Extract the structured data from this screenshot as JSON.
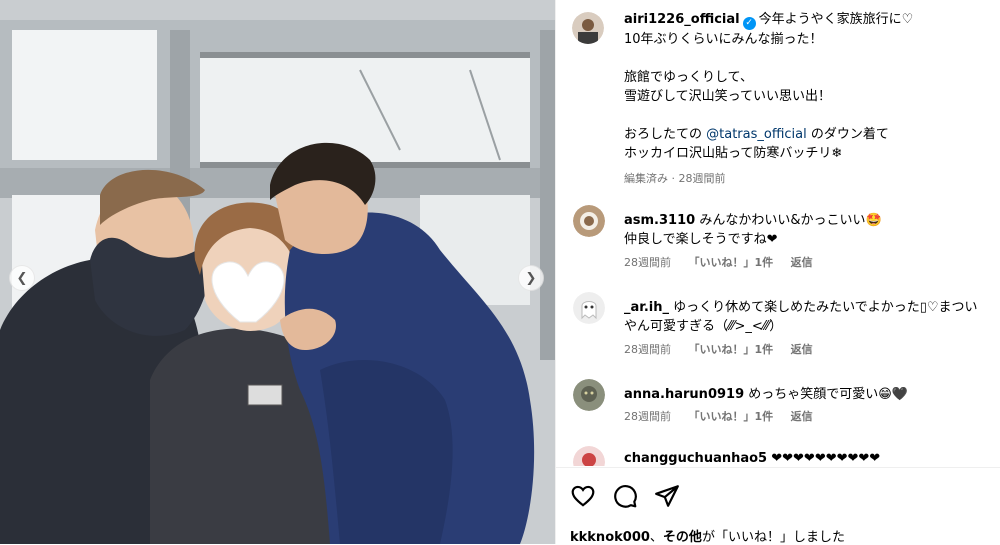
{
  "post": {
    "username": "airi1226_official",
    "caption_line1": "今年ようやく家族旅行に♡",
    "caption_line2": "10年ぶりくらいにみんな揃った！",
    "caption_line3": "旅館でゆっくりして、",
    "caption_line4": "雪遊びして沢山笑っていい思い出！",
    "caption_line5_pre": "おろしたての ",
    "caption_mention": "@tatras_official",
    "caption_line5_post": " のダウン着て",
    "caption_line6": "ホッカイロ沢山貼って防寒バッチリ❄",
    "meta": "編集済み · 28週間前"
  },
  "comments": [
    {
      "username": "asm.3110",
      "text_line1": "みんなかわいい&かっこいい🤩",
      "text_line2": "仲良しで楽しそうですね❤",
      "time": "28週間前",
      "likes": "「いいね！」1件",
      "reply": "返信"
    },
    {
      "username": "_ar.ih_",
      "text_line1": "ゆっくり休めて楽しめたみたいでよかった▯♡まつい",
      "text_line2": "やん可愛すぎる（⁄⁄⁄>_<⁄⁄⁄）",
      "time": "28週間前",
      "likes": "「いいね！」1件",
      "reply": "返信"
    },
    {
      "username": "anna.harun0919",
      "text_line1": "めっちゃ笑顔で可愛い😁🖤",
      "time": "28週間前",
      "likes": "「いいね！」1件",
      "reply": "返信"
    },
    {
      "username": "changguchuanhao5",
      "text_line1": "❤❤❤❤❤❤❤❤❤❤"
    }
  ],
  "likes_bar": {
    "user": "kkknok000",
    "sep": "、",
    "others": "その他",
    "suffix": "が「いいね！」しました"
  },
  "icons": {
    "heart": "heart-icon",
    "comment": "comment-icon",
    "share": "share-icon",
    "prev": "chevron-left-icon",
    "next": "chevron-right-icon"
  },
  "colors": {
    "verified": "#0095f6",
    "mention": "#00376b",
    "meta": "#737373"
  }
}
